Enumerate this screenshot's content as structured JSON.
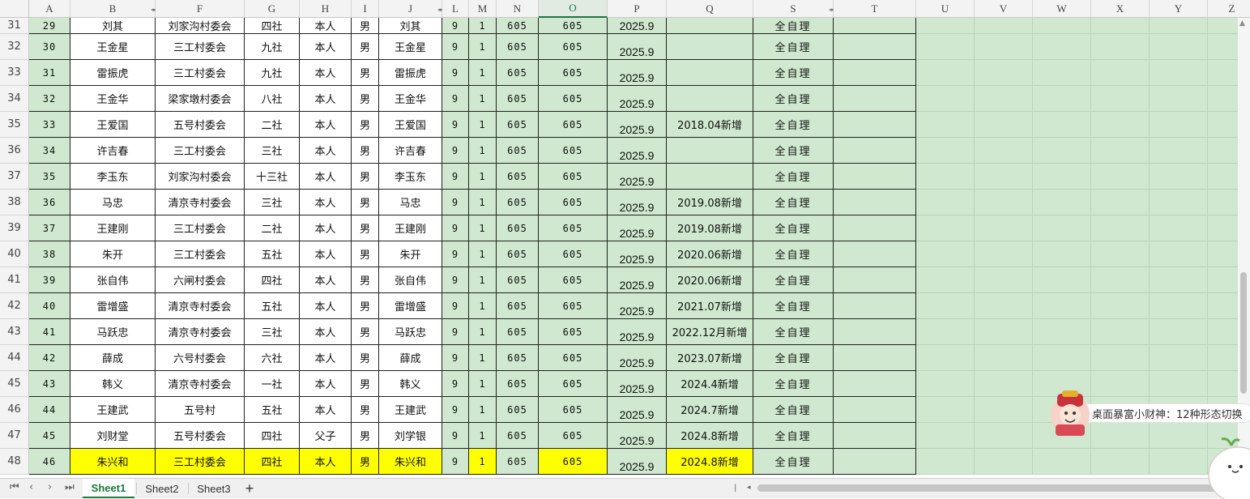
{
  "columns": [
    {
      "key": "A",
      "label": "A",
      "width": 51
    },
    {
      "key": "B",
      "label": "B",
      "width": 105
    },
    {
      "key": "F",
      "label": "F",
      "width": 110
    },
    {
      "key": "G",
      "label": "G",
      "width": 68
    },
    {
      "key": "H",
      "label": "H",
      "width": 64
    },
    {
      "key": "I",
      "label": "I",
      "width": 34
    },
    {
      "key": "J",
      "label": "J",
      "width": 78
    },
    {
      "key": "L",
      "label": "L",
      "width": 33
    },
    {
      "key": "M",
      "label": "M",
      "width": 34
    },
    {
      "key": "N",
      "label": "N",
      "width": 52
    },
    {
      "key": "O",
      "label": "O",
      "width": 85
    },
    {
      "key": "P",
      "label": "P",
      "width": 73
    },
    {
      "key": "Q",
      "label": "Q",
      "width": 107
    },
    {
      "key": "S",
      "label": "S",
      "width": 99
    },
    {
      "key": "T",
      "label": "T",
      "width": 102
    },
    {
      "key": "U",
      "label": "U",
      "width": 72
    },
    {
      "key": "V",
      "label": "V",
      "width": 72
    },
    {
      "key": "W",
      "label": "W",
      "width": 72
    },
    {
      "key": "X",
      "label": "X",
      "width": 72
    },
    {
      "key": "Y",
      "label": "Y",
      "width": 72
    },
    {
      "key": "Z",
      "label": "Z",
      "width": 60
    }
  ],
  "selected_column": "O",
  "rows": [
    {
      "row": "31",
      "cells": [
        "29",
        "刘其",
        "刘家沟村委会",
        "四社",
        "本人",
        "男",
        "刘其",
        "9",
        "1",
        "605",
        "605",
        "2025.9",
        "",
        "全自理"
      ]
    },
    {
      "row": "32",
      "cells": [
        "30",
        "王金星",
        "三工村委会",
        "九社",
        "本人",
        "男",
        "王金星",
        "9",
        "1",
        "605",
        "605",
        "2025.9",
        "",
        "全自理"
      ]
    },
    {
      "row": "33",
      "cells": [
        "31",
        "雷振虎",
        "三工村委会",
        "九社",
        "本人",
        "男",
        "雷振虎",
        "9",
        "1",
        "605",
        "605",
        "2025.9",
        "",
        "全自理"
      ]
    },
    {
      "row": "34",
      "cells": [
        "32",
        "王金华",
        "梁家墩村委会",
        "八社",
        "本人",
        "男",
        "王金华",
        "9",
        "1",
        "605",
        "605",
        "2025.9",
        "",
        "全自理"
      ]
    },
    {
      "row": "35",
      "cells": [
        "33",
        "王爱国",
        "五号村委会",
        "二社",
        "本人",
        "男",
        "王爱国",
        "9",
        "1",
        "605",
        "605",
        "2025.9",
        "2018.04新增",
        "全自理"
      ]
    },
    {
      "row": "36",
      "cells": [
        "34",
        "许吉春",
        "三工村委会",
        "三社",
        "本人",
        "男",
        "许吉春",
        "9",
        "1",
        "605",
        "605",
        "2025.9",
        "",
        "全自理"
      ]
    },
    {
      "row": "37",
      "cells": [
        "35",
        "李玉东",
        "刘家沟村委会",
        "十三社",
        "本人",
        "男",
        "李玉东",
        "9",
        "1",
        "605",
        "605",
        "2025.9",
        "",
        "全自理"
      ]
    },
    {
      "row": "38",
      "cells": [
        "36",
        "马忠",
        "清京寺村委会",
        "三社",
        "本人",
        "男",
        "马忠",
        "9",
        "1",
        "605",
        "605",
        "2025.9",
        "2019.08新增",
        "全自理"
      ]
    },
    {
      "row": "39",
      "cells": [
        "37",
        "王建刚",
        "三工村委会",
        "二社",
        "本人",
        "男",
        "王建刚",
        "9",
        "1",
        "605",
        "605",
        "2025.9",
        "2019.08新增",
        "全自理"
      ]
    },
    {
      "row": "40",
      "cells": [
        "38",
        "朱开",
        "三工村委会",
        "五社",
        "本人",
        "男",
        "朱开",
        "9",
        "1",
        "605",
        "605",
        "2025.9",
        "2020.06新增",
        "全自理"
      ]
    },
    {
      "row": "41",
      "cells": [
        "39",
        "张自伟",
        "六闸村委会",
        "四社",
        "本人",
        "男",
        "张自伟",
        "9",
        "1",
        "605",
        "605",
        "2025.9",
        "2020.06新增",
        "全自理"
      ]
    },
    {
      "row": "42",
      "cells": [
        "40",
        "雷增盛",
        "清京寺村委会",
        "五社",
        "本人",
        "男",
        "雷增盛",
        "9",
        "1",
        "605",
        "605",
        "2025.9",
        "2021.07新增",
        "全自理"
      ]
    },
    {
      "row": "43",
      "cells": [
        "41",
        "马跃忠",
        "清京寺村委会",
        "三社",
        "本人",
        "男",
        "马跃忠",
        "9",
        "1",
        "605",
        "605",
        "2025.9",
        "2022.12月新增",
        "全自理"
      ]
    },
    {
      "row": "44",
      "cells": [
        "42",
        "薛成",
        "六号村委会",
        "六社",
        "本人",
        "男",
        "薛成",
        "9",
        "1",
        "605",
        "605",
        "2025.9",
        "2023.07新增",
        "全自理"
      ]
    },
    {
      "row": "45",
      "cells": [
        "43",
        "韩义",
        "清京寺村委会",
        "一社",
        "本人",
        "男",
        "韩义",
        "9",
        "1",
        "605",
        "605",
        "2025.9",
        "2024.4新增",
        "全自理"
      ]
    },
    {
      "row": "46",
      "cells": [
        "44",
        "王建武",
        "五号村",
        "五社",
        "本人",
        "男",
        "王建武",
        "9",
        "1",
        "605",
        "605",
        "2025.9",
        "2024.7新增",
        "全自理"
      ]
    },
    {
      "row": "47",
      "cells": [
        "45",
        "刘财堂",
        "五号村委会",
        "四社",
        "父子",
        "男",
        "刘学银",
        "9",
        "1",
        "605",
        "605",
        "2025.9",
        "2024.8新增",
        "全自理"
      ]
    },
    {
      "row": "48",
      "cells": [
        "46",
        "朱兴和",
        "三工村委会",
        "四社",
        "本人",
        "男",
        "朱兴和",
        "9",
        "1",
        "605",
        "605",
        "2025.9",
        "2024.8新增",
        "全自理"
      ],
      "highlight": true
    }
  ],
  "colors": {
    "green_fill": "#cfe8cf",
    "white_fill": "#ffffff",
    "yellow_fill": "#ffff00",
    "accent": "#1a7a3a"
  },
  "sheet_tabs": [
    {
      "label": "Sheet1",
      "active": true
    },
    {
      "label": "Sheet2",
      "active": false
    },
    {
      "label": "Sheet3",
      "active": false
    }
  ],
  "add_sheet_label": "+",
  "nav": {
    "first": "⏮",
    "prev": "‹",
    "next": "›",
    "last": "⏭"
  },
  "widget_text": "桌面暴富小财神：12种形态切换"
}
